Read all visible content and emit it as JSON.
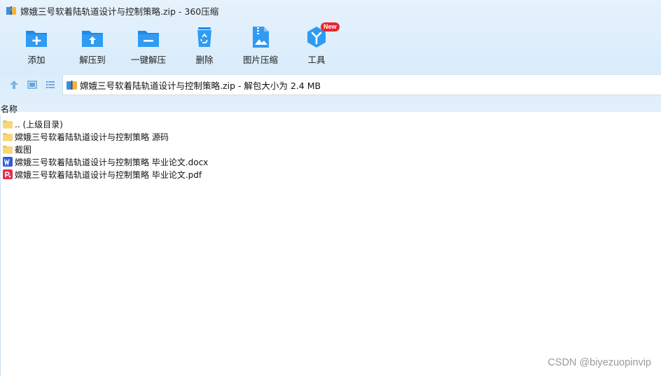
{
  "window": {
    "title": "嫦娥三号软着陆轨道设计与控制策略.zip - 360压缩"
  },
  "toolbar": {
    "items": [
      {
        "label": "添加",
        "icon": "add-icon"
      },
      {
        "label": "解压到",
        "icon": "extract-to-icon"
      },
      {
        "label": "一键解压",
        "icon": "one-click-extract-icon"
      },
      {
        "label": "删除",
        "icon": "recycle-bin-icon"
      },
      {
        "label": "图片压缩",
        "icon": "image-compress-icon"
      },
      {
        "label": "工具",
        "icon": "tools-icon",
        "badge": "New"
      }
    ]
  },
  "address": {
    "path": "嫦娥三号软着陆轨道设计与控制策略.zip - 解包大小为 2.4 MB"
  },
  "list": {
    "column_name": "名称",
    "items": [
      {
        "name": ".. (上级目录)",
        "type": "folder"
      },
      {
        "name": "嫦娥三号软着陆轨道设计与控制策略 源码",
        "type": "folder"
      },
      {
        "name": "截图",
        "type": "folder"
      },
      {
        "name": "嫦娥三号软着陆轨道设计与控制策略 毕业论文.docx",
        "type": "word"
      },
      {
        "name": "嫦娥三号软着陆轨道设计与控制策略 毕业论文.pdf",
        "type": "pdf"
      }
    ]
  },
  "watermark": "CSDN @biyezuopinvip",
  "colors": {
    "accent": "#1e8be8",
    "chrome_bg": "#dcedfb",
    "badge": "#e8262e",
    "folder": "#f7d77a",
    "word": "#2b5fd9",
    "pdf": "#e0304e"
  }
}
